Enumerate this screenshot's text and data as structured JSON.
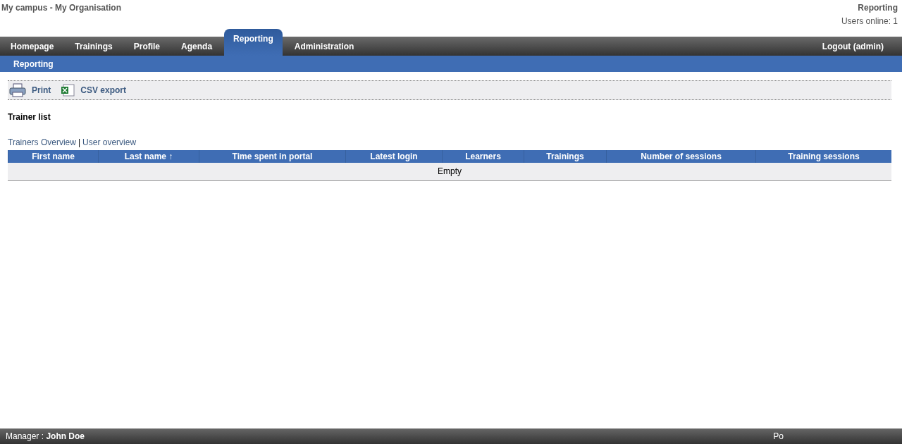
{
  "header": {
    "site_title": "My campus - My Organisation",
    "section": "Reporting",
    "users_online": "Users online: 1"
  },
  "tabs": [
    {
      "label": "Homepage",
      "selected": false
    },
    {
      "label": "Trainings",
      "selected": false
    },
    {
      "label": "Profile",
      "selected": false
    },
    {
      "label": "Agenda",
      "selected": false
    },
    {
      "label": "Reporting",
      "selected": true
    },
    {
      "label": "Administration",
      "selected": false
    }
  ],
  "logout": "Logout (admin)",
  "subnav": [
    "Reporting"
  ],
  "actions": [
    {
      "kind": "print",
      "label": "Print"
    },
    {
      "kind": "csv",
      "label": "CSV export"
    }
  ],
  "page_title": "Trainer list",
  "views": [
    "Trainers Overview",
    "User overview"
  ],
  "view_separator": "|",
  "table": {
    "columns": [
      "First name",
      "Last name ↑",
      "Time spent in portal",
      "Latest login",
      "Learners",
      "Trainings",
      "Number of sessions",
      "Training sessions"
    ],
    "empty": "Empty"
  },
  "footer": {
    "manager": "Manager : **John Doe**",
    "right": "Po"
  }
}
